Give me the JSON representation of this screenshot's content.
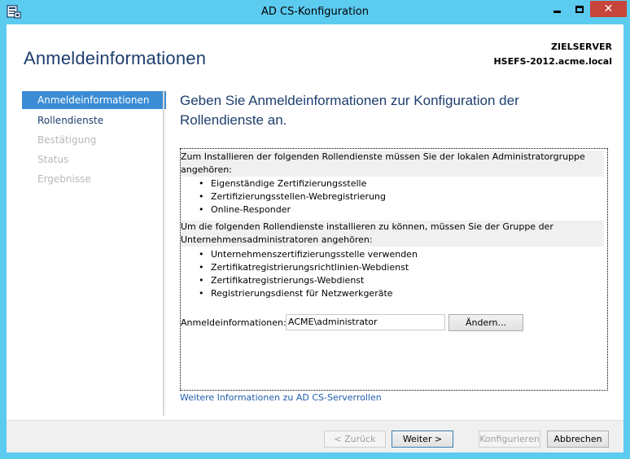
{
  "window": {
    "title": "AD CS-Konfiguration"
  },
  "header": {
    "page_title": "Anmeldeinformationen",
    "server_label": "ZIELSERVER",
    "server_name": "HSEFS-2012.acme.local"
  },
  "sidebar": {
    "items": [
      {
        "label": "Anmeldeinformationen",
        "state": "active"
      },
      {
        "label": "Rollendienste",
        "state": "enabled"
      },
      {
        "label": "Bestätigung",
        "state": "disabled"
      },
      {
        "label": "Status",
        "state": "disabled"
      },
      {
        "label": "Ergebnisse",
        "state": "disabled"
      }
    ]
  },
  "main": {
    "heading": "Geben Sie Anmeldeinformationen zur Konfiguration der Rollendienste an.",
    "local_admin_text": "Zum Installieren der folgenden Rollendienste müssen Sie der lokalen Administratorgruppe angehören:",
    "local_admin_services": [
      "Eigenständige Zertifizierungsstelle",
      "Zertifizierungsstellen-Webregistrierung",
      "Online-Responder"
    ],
    "enterprise_admin_text": "Um die folgenden Rollendienste installieren zu können, müssen Sie der Gruppe der Unternehmensadministratoren angehören:",
    "enterprise_admin_services": [
      "Unternehmenszertifizierungsstelle verwenden",
      "Zertifikatregistrierungsrichtlinien-Webdienst",
      "Zertifikatregistrierungs-Webdienst",
      "Registrierungsdienst für Netzwerkgeräte"
    ],
    "credentials_label": "Anmeldeinformationen:",
    "credentials_value": "ACME\\administrator",
    "change_button": "Ändern...",
    "more_info_link": "Weitere Informationen zu AD CS-Serverrollen"
  },
  "footer": {
    "back_label": "< Zurück",
    "next_label": "Weiter >",
    "configure_label": "Konfigurieren",
    "cancel_label": "Abbrechen"
  },
  "colors": {
    "title_bar": "#5ccbf0",
    "accent_text": "#1e3e6e",
    "nav_active": "#3a8dd4",
    "close_button": "#c7453a",
    "link": "#1e5eaa"
  },
  "icons": {
    "app": "server-manager-icon",
    "minimize": "minimize-icon",
    "maximize": "maximize-icon",
    "close": "close-icon"
  }
}
